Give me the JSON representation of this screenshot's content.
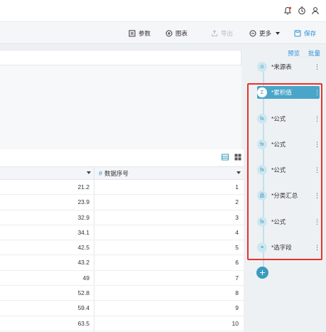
{
  "header": {
    "icons": [
      "notification-icon",
      "clock-icon",
      "user-icon"
    ]
  },
  "toolbar": {
    "params_label": "参数",
    "chart_label": "图表",
    "export_label": "导出",
    "more_label": "更多",
    "save_label": "保存"
  },
  "table": {
    "col2_header": "数据序号",
    "col2_type_icon": "#",
    "rows": [
      {
        "value": "21.2",
        "index": "1"
      },
      {
        "value": "23.9",
        "index": "2"
      },
      {
        "value": "32.9",
        "index": "3"
      },
      {
        "value": "34.1",
        "index": "4"
      },
      {
        "value": "42.5",
        "index": "5"
      },
      {
        "value": "43.2",
        "index": "6"
      },
      {
        "value": "49",
        "index": "7"
      },
      {
        "value": "52.8",
        "index": "8"
      },
      {
        "value": "59.4",
        "index": "9"
      },
      {
        "value": "63.5",
        "index": "10"
      }
    ]
  },
  "sidebar": {
    "preview_label": "预览",
    "batch_label": "批量",
    "steps": [
      {
        "label": "*来源表",
        "icon": "source-icon",
        "glyph": "⊙"
      },
      {
        "label": "*累积值",
        "icon": "cumulative-icon",
        "glyph": "Σ",
        "selected": true
      },
      {
        "label": "*公式",
        "icon": "formula-icon",
        "glyph": "fx"
      },
      {
        "label": "*公式",
        "icon": "formula-icon",
        "glyph": "fx"
      },
      {
        "label": "*公式",
        "icon": "formula-icon",
        "glyph": "fx"
      },
      {
        "label": "*分类汇总",
        "icon": "group-summary-icon",
        "glyph": "品"
      },
      {
        "label": "*公式",
        "icon": "formula-icon",
        "glyph": "fx"
      },
      {
        "label": "*选字段",
        "icon": "select-fields-icon",
        "glyph": "≡"
      }
    ],
    "more_glyph": "⋮",
    "add_glyph": "+"
  },
  "colors": {
    "accent": "#2b91d6",
    "selected_step": "#4aa6c9",
    "highlight_box": "#e5332a"
  }
}
